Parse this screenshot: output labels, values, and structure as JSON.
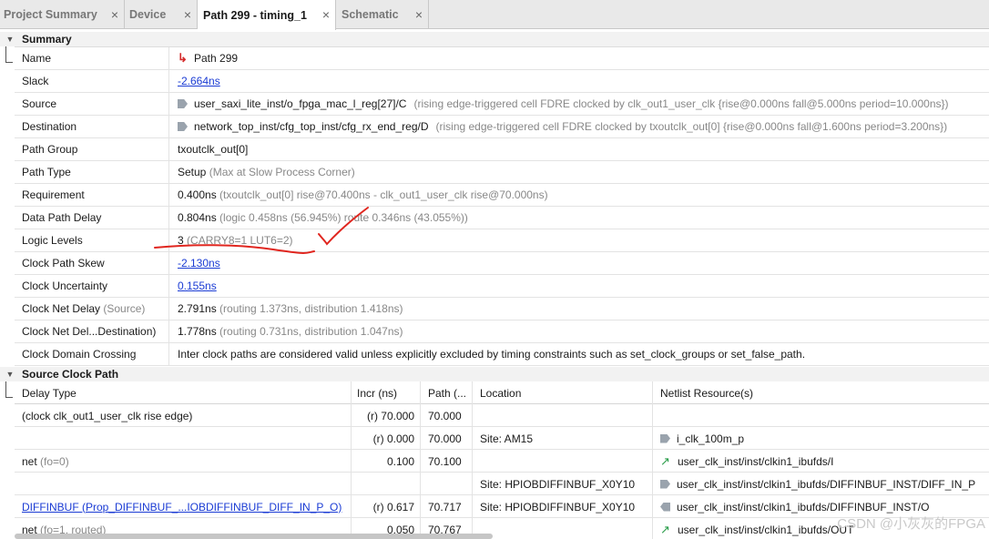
{
  "tabs": [
    {
      "label": "Project Summary",
      "close": "×"
    },
    {
      "label": "Device",
      "close": "×"
    },
    {
      "label": "Path 299 - timing_1",
      "close": "×"
    },
    {
      "label": "Schematic",
      "close": "×"
    }
  ],
  "summary": {
    "title": "Summary",
    "name_label": "Name",
    "name_value": "Path 299",
    "slack_label": "Slack",
    "slack_value": "-2.664ns",
    "source_label": "Source",
    "source_value": "user_saxi_lite_inst/o_fpga_mac_l_reg[27]/C",
    "source_detail": "(rising edge-triggered cell FDRE clocked by clk_out1_user_clk  {rise@0.000ns fall@5.000ns period=10.000ns})",
    "dest_label": "Destination",
    "dest_value": "network_top_inst/cfg_top_inst/cfg_rx_end_reg/D",
    "dest_detail": "(rising edge-triggered cell FDRE clocked by txoutclk_out[0]  {rise@0.000ns fall@1.600ns period=3.200ns})",
    "group_label": "Path Group",
    "group_value": "txoutclk_out[0]",
    "type_label": "Path Type",
    "type_value": "Setup",
    "type_detail": "(Max at Slow Process Corner)",
    "req_label": "Requirement",
    "req_value": "0.400ns",
    "req_detail": "(txoutclk_out[0] rise@70.400ns - clk_out1_user_clk rise@70.000ns)",
    "dpd_label": "Data Path Delay",
    "dpd_value": "0.804ns",
    "dpd_detail": "(logic 0.458ns (56.945%)  route 0.346ns (43.055%))",
    "ll_label": "Logic Levels",
    "ll_value": "3",
    "ll_detail": "(CARRY8=1 LUT6=2)",
    "cps_label": "Clock Path Skew",
    "cps_value": "-2.130ns",
    "cu_label": "Clock Uncertainty",
    "cu_value": "0.155ns",
    "cnd_label": "Clock Net Delay",
    "cnd_label_muted": "(Source)",
    "cnd_value": "2.791ns",
    "cnd_detail": "(routing 1.373ns, distribution 1.418ns)",
    "cndd_label": "Clock Net Del...Destination)",
    "cndd_value": "1.778ns",
    "cndd_detail": "(routing 0.731ns, distribution 1.047ns)",
    "cdc_label": "Clock Domain Crossing",
    "cdc_value": "Inter clock paths are considered valid unless explicitly excluded by timing constraints such as set_clock_groups or set_false_path."
  },
  "source_clock_path": {
    "title": "Source Clock Path",
    "headers": [
      "Delay Type",
      "Incr (ns)",
      "Path (...",
      "Location",
      "Netlist Resource(s)"
    ],
    "rows": [
      {
        "type": "(clock clk_out1_user_clk rise edge)",
        "type_muted": "",
        "incr": "(r) 70.000",
        "path": "70.000",
        "loc": "",
        "res": ""
      },
      {
        "type": "",
        "type_muted": "",
        "incr": "(r) 0.000",
        "path": "70.000",
        "loc": "Site: AM15",
        "res": "i_clk_100m_p"
      },
      {
        "type": "net",
        "type_muted": "(fo=0)",
        "incr": "0.100",
        "path": "70.100",
        "loc": "",
        "res": "user_clk_inst/inst/clkin1_ibufds/I"
      },
      {
        "type": "",
        "type_muted": "",
        "incr": "",
        "path": "",
        "loc": "Site: HPIOBDIFFINBUF_X0Y10",
        "res": "user_clk_inst/inst/clkin1_ibufds/DIFFINBUF_INST/DIFF_IN_P"
      },
      {
        "type": "DIFFINBUF (Prop_DIFFINBUF_...IOBDIFFINBUF_DIFF_IN_P_O)",
        "type_muted": "",
        "incr": "(r) 0.617",
        "path": "70.717",
        "loc": "Site: HPIOBDIFFINBUF_X0Y10",
        "res": "user_clk_inst/inst/clkin1_ibufds/DIFFINBUF_INST/O"
      },
      {
        "type": "net",
        "type_muted": "(fo=1, routed)",
        "incr": "0.050",
        "path": "70.767",
        "loc": "",
        "res": "user_clk_inst/inst/clkin1_ibufds/OUT"
      }
    ]
  },
  "watermark": "CSDN @小灰灰的FPGA",
  "icons": {
    "path": "path-arrow-icon",
    "pin_in": "pin-input-icon",
    "net": "net-arrow-icon",
    "pin_out": "pin-output-icon"
  },
  "colors": {
    "link": "#1a3bd4",
    "annotation": "#e0261f",
    "net_icon": "#2a9d4a"
  }
}
